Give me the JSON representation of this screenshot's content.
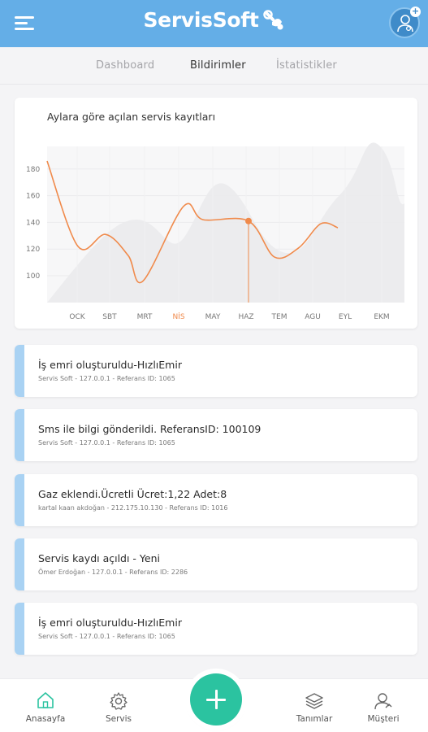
{
  "app": {
    "brand": "ServisSoft",
    "menu_icon": "hamburger-menu-icon",
    "avatar_icon": "user-settings-icon",
    "avatar_badge": "+"
  },
  "tabs": [
    {
      "label": "Dashboard",
      "active": false
    },
    {
      "label": "Bildirimler",
      "active": true
    },
    {
      "label": "İstatistikler",
      "active": false
    }
  ],
  "chart_data": {
    "type": "line",
    "title": "Aylara göre açılan servis kayıtları",
    "categories": [
      "OCK",
      "SBT",
      "MRT",
      "NİS",
      "MAY",
      "HAZ",
      "TEM",
      "AGU",
      "EYL",
      "EKM"
    ],
    "highlighted_category": "NİS",
    "series": [
      {
        "values": [
          186,
          122,
          131,
          115,
          96,
          152,
          142,
          141,
          114,
          121,
          139,
          136
        ],
        "color": "#f08a4b"
      }
    ],
    "y_ticks": [
      100,
      120,
      140,
      160,
      180
    ],
    "ylim": [
      80,
      190
    ],
    "tooltip_point": {
      "category": "HAZ",
      "value": 141
    },
    "grid": true,
    "legend": "none"
  },
  "notifications": [
    {
      "title": "İş emri oluşturuldu-HızlıEmir",
      "meta": "Servis Soft - 127.0.0.1 - Referans ID: 1065"
    },
    {
      "title": "Sms ile bilgi gönderildi. ReferansID: 100109",
      "meta": "Servis Soft - 127.0.0.1 - Referans ID: 1065"
    },
    {
      "title": "Gaz eklendi.Ücretli Ücret:1,22 Adet:8",
      "meta": "kartal kaan akdoğan - 212.175.10.130 - Referans ID: 1016"
    },
    {
      "title": "Servis kaydı açıldı - Yeni",
      "meta": "Ömer Erdoğan - 127.0.0.1 - Referans ID: 2286"
    },
    {
      "title": "İş emri oluşturuldu-HızlıEmir",
      "meta": "Servis Soft - 127.0.0.1 - Referans ID: 1065"
    }
  ],
  "bottom_nav": {
    "home": "Anasayfa",
    "servis": "Servis",
    "tanimlar": "Tanımlar",
    "musteri": "Müşteri",
    "fab": "+"
  },
  "colors": {
    "header": "#64aee7",
    "accent_line": "#f08a4b",
    "notif_bar": "#a9d2f3",
    "fab": "#2bc3a0",
    "active_nav": "#2bc3a0"
  }
}
